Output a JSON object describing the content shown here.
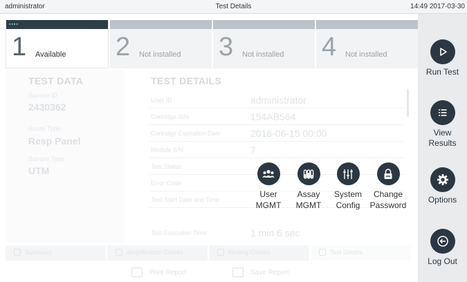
{
  "topbar": {
    "user": "administrator",
    "title": "Test Details",
    "clock": "14:49 2017-03-30"
  },
  "modules": [
    {
      "number": "1",
      "label": "Available",
      "active": true
    },
    {
      "number": "2",
      "label": "Not installed",
      "active": false
    },
    {
      "number": "3",
      "label": "Not installed",
      "active": false
    },
    {
      "number": "4",
      "label": "Not installed",
      "active": false
    }
  ],
  "test_data": {
    "title": "TEST DATA",
    "sample_id_label": "Sample ID",
    "sample_id": "2430362",
    "assay_type_label": "Assay Type",
    "assay_type": "Resp Panel",
    "sample_type_label": "Sample Type",
    "sample_type": "UTM"
  },
  "test_details": {
    "title": "TEST DETAILS",
    "rows": [
      {
        "label": "User ID",
        "value": "administrator"
      },
      {
        "label": "Cartridge S/N",
        "value": "154AB564"
      },
      {
        "label": "Cartridge Expiration Date",
        "value": "2016-06-15 00:00"
      },
      {
        "label": "Module S/N",
        "value": "7"
      },
      {
        "label": "Test Status",
        "value": ""
      },
      {
        "label": "Error Code",
        "value": ""
      },
      {
        "label": "Test Start Date and Time",
        "value": ""
      },
      {
        "label": "Test Execution Time",
        "value": "1 min 6 sec"
      }
    ]
  },
  "bottom_tabs": [
    "Summary",
    "Amplification Curves",
    "Melting Curves",
    "Test Details"
  ],
  "actions": {
    "print": "Print Report",
    "save": "Save Report"
  },
  "sidenav": {
    "run_test": "Run Test",
    "view_results_1": "View",
    "view_results_2": "Results",
    "options": "Options",
    "log_out": "Log Out"
  },
  "popup": {
    "user_1": "User",
    "user_2": "MGMT",
    "assay_1": "Assay",
    "assay_2": "MGMT",
    "system_1": "System",
    "system_2": "Config",
    "change_1": "Change",
    "change_2": "Password"
  },
  "colors": {
    "accent_dark": "#2b3843",
    "sidebar_bg": "#e9ebed"
  }
}
